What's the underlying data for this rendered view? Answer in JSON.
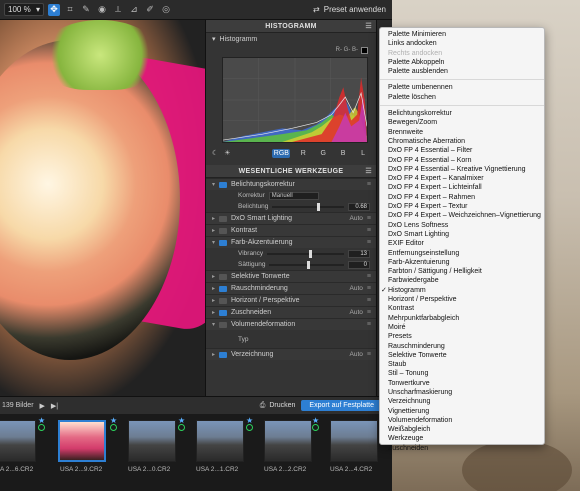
{
  "toolbar": {
    "zoom": "100 %",
    "preset_label": "Preset anwenden",
    "tools": [
      "move-tool-icon",
      "crop-icon",
      "picker-icon",
      "red-eye-icon",
      "straighten-icon",
      "perspective-icon",
      "brush-icon",
      "repair-icon"
    ]
  },
  "histogram_panel": {
    "title": "HISTOGRAMM",
    "subhead": "Histogramm",
    "rgb_readout": "R- G- B-",
    "channels": [
      "RGB",
      "R",
      "G",
      "B",
      "L"
    ]
  },
  "tools_panel": {
    "title": "WESENTLICHE WERKZEUGE",
    "rows": [
      {
        "name": "Belichtungskorrektur",
        "auto": ""
      },
      {
        "name": "DxO Smart Lighting",
        "auto": "Auto"
      },
      {
        "name": "Kontrast",
        "auto": ""
      },
      {
        "name": "Farb-Akzentuierung",
        "auto": ""
      },
      {
        "name": "Selektive Tonwerte",
        "auto": ""
      },
      {
        "name": "Rauschminderung",
        "auto": "Auto"
      },
      {
        "name": "Horizont / Perspektive",
        "auto": ""
      },
      {
        "name": "Zuschneiden",
        "auto": "Auto"
      },
      {
        "name": "Volumendeformation",
        "auto": ""
      },
      {
        "name": "Verzeichnung",
        "auto": "Auto"
      }
    ],
    "korrektur_label": "Korrektur",
    "korrektur_value": "Manuell",
    "belichtung_label": "Belichtung",
    "belichtung_value": "0.68",
    "vibrancy_label": "Vibrancy",
    "vibrancy_value": "13",
    "saettigung_label": "Sättigung",
    "saettigung_value": "0",
    "typ_label": "Typ"
  },
  "filmstrip": {
    "count": "139 Bilder",
    "print_label": "Drucken",
    "export_label": "Export auf Festplatte",
    "thumbs": [
      "A 2...6.CR2",
      "USA 2...9.CR2",
      "USA 2...0.CR2",
      "USA 2...1.CR2",
      "USA 2...2.CR2",
      "USA 2...4.CR2"
    ]
  },
  "context_menu": {
    "group1": [
      {
        "label": "Palette Minimieren",
        "disabled": false
      },
      {
        "label": "Links andocken",
        "disabled": false
      },
      {
        "label": "Rechts andocken",
        "disabled": true
      },
      {
        "label": "Palette Abkoppeln",
        "disabled": false
      },
      {
        "label": "Palette ausblenden",
        "disabled": false
      }
    ],
    "group2": [
      {
        "label": "Palette umbenennen",
        "disabled": false
      },
      {
        "label": "Palette löschen",
        "disabled": false
      }
    ],
    "group3": [
      {
        "label": "Belichtungskorrektur",
        "checked": false
      },
      {
        "label": "Bewegen/Zoom",
        "checked": false
      },
      {
        "label": "Brennweite",
        "checked": false
      },
      {
        "label": "Chromatische Aberration",
        "checked": false
      },
      {
        "label": "DxO FP 4 Essential – Filter",
        "checked": false
      },
      {
        "label": "DxO FP 4 Essential – Korn",
        "checked": false
      },
      {
        "label": "DxO FP 4 Essential – Kreative Vignettierung",
        "checked": false
      },
      {
        "label": "DxO FP 4 Expert – Kanalmixer",
        "checked": false
      },
      {
        "label": "DxO FP 4 Expert – Lichteinfall",
        "checked": false
      },
      {
        "label": "DxO FP 4 Expert – Rahmen",
        "checked": false
      },
      {
        "label": "DxO FP 4 Expert – Textur",
        "checked": false
      },
      {
        "label": "DxO FP 4 Expert – Weichzeichnen–Vignettierung",
        "checked": false
      },
      {
        "label": "DxO Lens Softness",
        "checked": false
      },
      {
        "label": "DxO Smart Lighting",
        "checked": false
      },
      {
        "label": "EXIF Editor",
        "checked": false
      },
      {
        "label": "Entfernungseinstellung",
        "checked": false
      },
      {
        "label": "Farb-Akzentuierung",
        "checked": false
      },
      {
        "label": "Farbton / Sättigung / Helligkeit",
        "checked": false
      },
      {
        "label": "Farbwiedergabe",
        "checked": false
      },
      {
        "label": "Histogramm",
        "checked": true
      },
      {
        "label": "Horizont / Perspektive",
        "checked": false
      },
      {
        "label": "Kontrast",
        "checked": false
      },
      {
        "label": "Mehrpunktfarbabgleich",
        "checked": false
      },
      {
        "label": "Moiré",
        "checked": false
      },
      {
        "label": "Presets",
        "checked": false
      },
      {
        "label": "Rauschminderung",
        "checked": false
      },
      {
        "label": "Selektive Tonwerte",
        "checked": false
      },
      {
        "label": "Staub",
        "checked": false
      },
      {
        "label": "Stil – Tonung",
        "checked": false
      },
      {
        "label": "Tonwertkurve",
        "checked": false
      },
      {
        "label": "Unscharfmaskierung",
        "checked": false
      },
      {
        "label": "Verzeichnung",
        "checked": false
      },
      {
        "label": "Vignettierung",
        "checked": false
      },
      {
        "label": "Volumendeformation",
        "checked": false
      },
      {
        "label": "Weißabgleich",
        "checked": false
      },
      {
        "label": "Werkzeuge",
        "checked": false
      },
      {
        "label": "Zuschneiden",
        "checked": false
      }
    ]
  },
  "colors": {
    "accent": "#2d7fd3",
    "menu_bg": "#f5f5f5",
    "panel_bg": "#343434"
  }
}
